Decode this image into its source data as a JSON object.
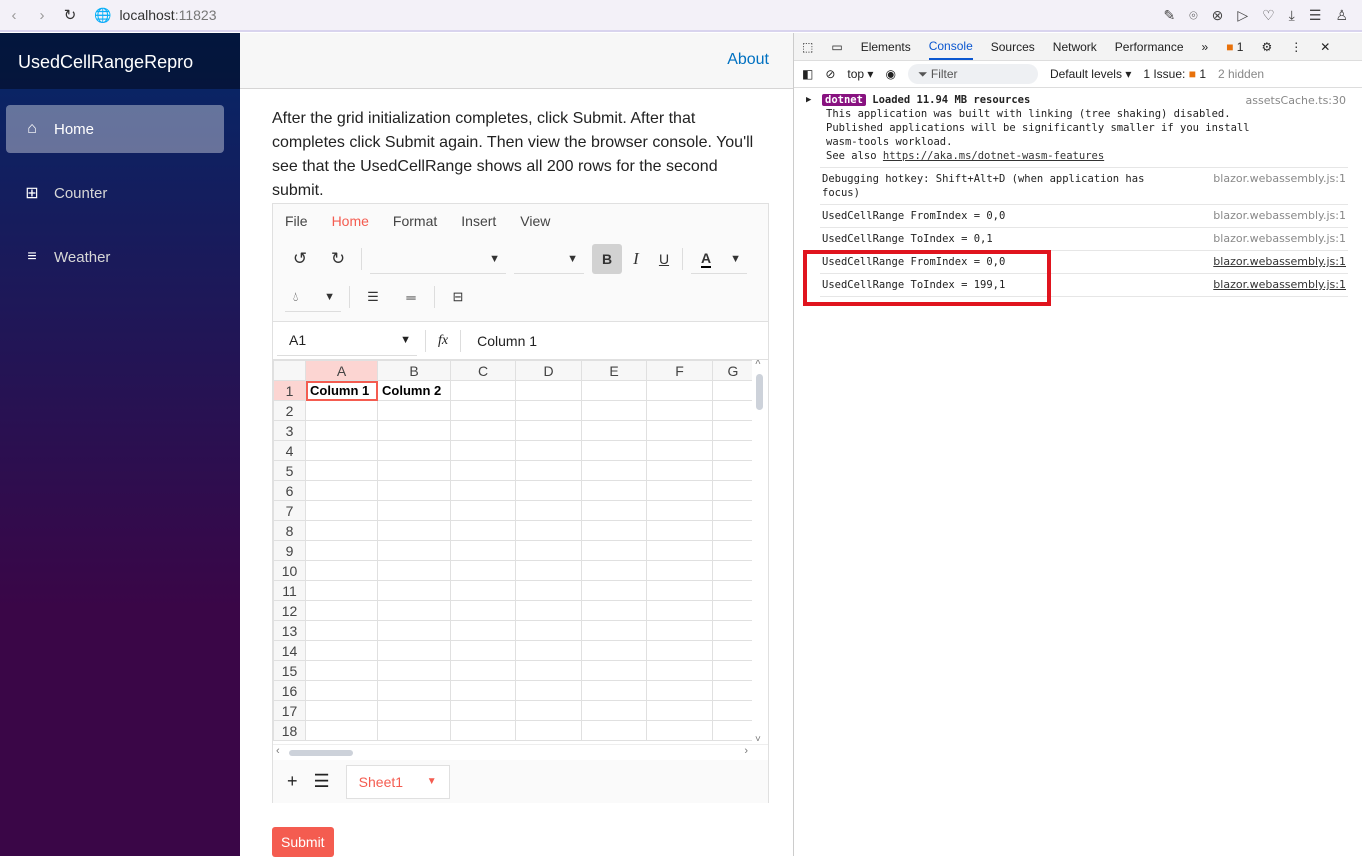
{
  "browser": {
    "host": "localhost",
    "port": ":11823"
  },
  "sidebar": {
    "title": "UsedCellRangeRepro",
    "items": [
      {
        "label": "Home",
        "icon": "home-icon"
      },
      {
        "label": "Counter",
        "icon": "plus-icon"
      },
      {
        "label": "Weather",
        "icon": "list-icon"
      }
    ]
  },
  "topbar": {
    "about": "About"
  },
  "description": "After the grid initialization completes, click Submit. After that completes click Submit again. Then view the browser console. You'll see that the UsedCellRange shows all 200 rows for the second submit.",
  "spreadsheet": {
    "menu": [
      "File",
      "Home",
      "Format",
      "Insert",
      "View"
    ],
    "active_menu": "Home",
    "name_box": "A1",
    "fx": "fx",
    "formula": "Column 1",
    "columns": [
      "A",
      "B",
      "C",
      "D",
      "E",
      "F",
      "G"
    ],
    "rows": [
      "1",
      "2",
      "3",
      "4",
      "5",
      "6",
      "7",
      "8",
      "9",
      "10",
      "11",
      "12",
      "13",
      "14",
      "15",
      "16",
      "17",
      "18"
    ],
    "cells": {
      "A1": "Column 1",
      "B1": "Column 2"
    },
    "sheet": "Sheet1",
    "bold": "B",
    "italic": "I",
    "underline": "U",
    "font_color": "A"
  },
  "submit": "Submit",
  "devtools": {
    "tabs": [
      "Elements",
      "Console",
      "Sources",
      "Network",
      "Performance"
    ],
    "active_tab": "Console",
    "issues_count": "1",
    "context": "top",
    "filter": "Filter",
    "levels": "Default levels",
    "issues": "1 Issue:",
    "issues_n": "1",
    "hidden": "2 hidden",
    "logs": [
      {
        "badge": "dotnet",
        "bold": "Loaded 11.94 MB resources",
        "lines": [
          "This application was built with linking (tree shaking) disabled.",
          "Published applications will be significantly smaller if you install wasm-tools workload."
        ],
        "see": "See also ",
        "link": "https://aka.ms/dotnet-wasm-features",
        "src": "assetsCache.ts:30"
      },
      {
        "text": "Debugging hotkey: Shift+Alt+D (when application has focus)",
        "src": "blazor.webassembly.js:1"
      },
      {
        "text": "UsedCellRange FromIndex = 0,0",
        "src": "blazor.webassembly.js:1"
      },
      {
        "text": "UsedCellRange ToIndex = 0,1",
        "src": "blazor.webassembly.js:1"
      },
      {
        "text": "UsedCellRange FromIndex = 0,0",
        "src": "blazor.webassembly.js:1"
      },
      {
        "text": "UsedCellRange ToIndex = 199,1",
        "src": "blazor.webassembly.js:1"
      }
    ],
    "highlight_color": "#e0141e"
  }
}
